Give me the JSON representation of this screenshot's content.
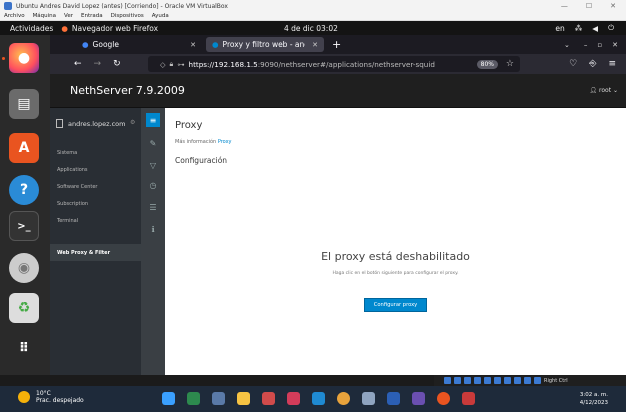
{
  "vbox": {
    "title": "Ubuntu Andres David Lopez (antes) [Corriendo] - Oracle VM VirtualBox",
    "menu": [
      "Archivo",
      "Máquina",
      "Ver",
      "Entrada",
      "Dispositivos",
      "Ayuda"
    ],
    "status_label": "Right Ctrl"
  },
  "gnome": {
    "activities": "Actividades",
    "app_name": "Navegador web Firefox",
    "clock": "4 de dic  03:02",
    "lang": "en"
  },
  "firefox": {
    "tabs": [
      {
        "label": "Google"
      },
      {
        "label": "Proxy y filtro web - andre"
      }
    ],
    "url_host": "https://192.168.1.5",
    "url_rest": ":9090/nethserver#/applications/nethserver-squid",
    "zoom": "80%"
  },
  "nethserver": {
    "brand": "NethServer 7.9.2009",
    "user": "root",
    "host": "andres.lopez.com",
    "nav": [
      "Sistema",
      "Applications",
      "Software Center",
      "Subscription",
      "Terminal",
      "Web Proxy & Filter"
    ],
    "page_title": "Proxy",
    "more_info": "Más información",
    "more_info_link": "Proxy",
    "section": "Configuración",
    "empty_title": "El proxy está deshabilitado",
    "empty_desc": "Haga clic en el botón siguiente para configurar el proxy.",
    "configure_button": "Configurar proxy"
  },
  "taskbar": {
    "weather_temp": "10°C",
    "weather_desc": "Prac. despejado",
    "time": "3:02 a. m.",
    "date": "4/12/2023"
  },
  "colors": {
    "accent": "#0088ce",
    "ubuntu_orange": "#e95420"
  }
}
